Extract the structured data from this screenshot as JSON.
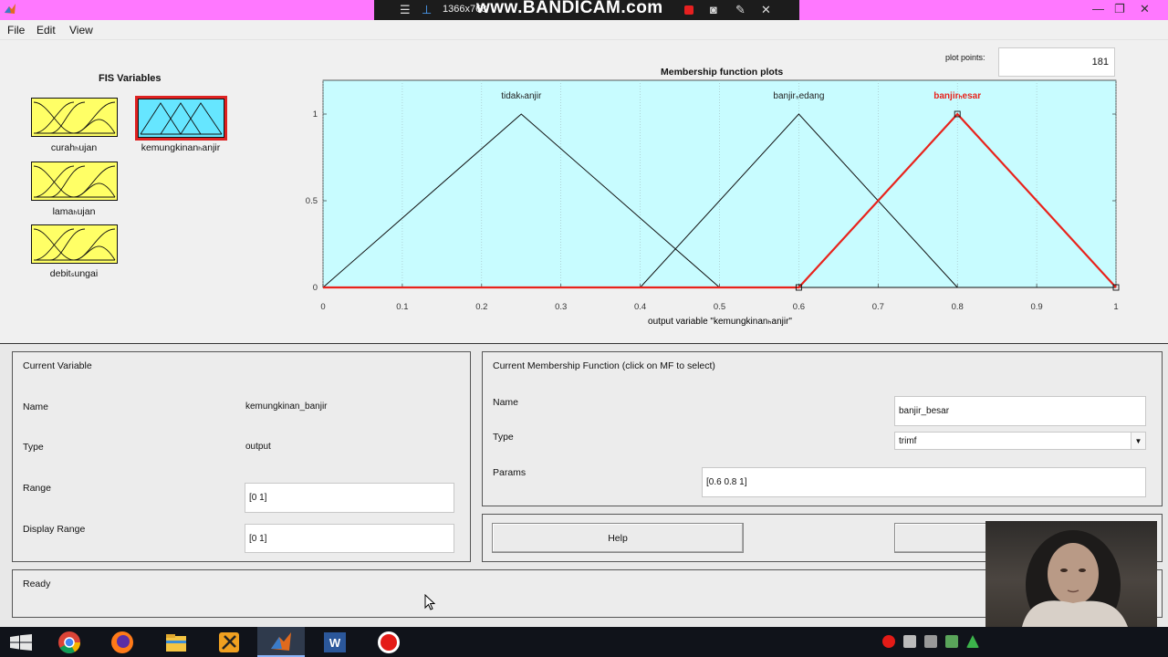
{
  "window": {
    "titlebar_color": "#ff78ff",
    "recorder": {
      "resolution": "1366x768",
      "watermark": "www.BANDICAM.com"
    }
  },
  "menu": [
    "File",
    "Edit",
    "View"
  ],
  "fis_variables": {
    "title": "FIS Variables",
    "items": [
      {
        "label": "curah_hujan",
        "label_display": "curahₕujan",
        "kind": "input",
        "selected": false
      },
      {
        "label": "kemungkinan_banjir",
        "label_display": "kemungkinanₕanjir",
        "kind": "output",
        "selected": true
      },
      {
        "label": "lama_hujan",
        "label_display": "lamaₕujan",
        "kind": "input",
        "selected": false
      },
      {
        "label": "debit_sungai",
        "label_display": "debitₛungai",
        "kind": "input",
        "selected": false
      }
    ],
    "input_color": "#ffff66",
    "output_color": "#66e6ff",
    "selected_outline": "#dd2222"
  },
  "plot": {
    "title": "Membership function plots",
    "plot_points_label": "plot points:",
    "plot_points_value": "181",
    "background": "#c8fcff",
    "xlabel": "output variable \"kemungkinanₕanjir\"",
    "xticks": [
      "0",
      "0.1",
      "0.2",
      "0.3",
      "0.4",
      "0.5",
      "0.6",
      "0.7",
      "0.8",
      "0.9",
      "1"
    ],
    "yticks": [
      "0",
      "0.5",
      "1"
    ]
  },
  "chart_data": {
    "type": "line",
    "xlim": [
      0,
      1
    ],
    "ylim": [
      0,
      1
    ],
    "series": [
      {
        "name": "tidak_banjir",
        "label_display": "tidakₕanjir",
        "type": "trimf",
        "params": [
          0,
          0.25,
          0.5
        ],
        "color": "#111111",
        "selected": false
      },
      {
        "name": "banjir_sedang",
        "label_display": "banjirₛedang",
        "type": "trimf",
        "params": [
          0.4,
          0.6,
          0.8
        ],
        "color": "#111111",
        "selected": false
      },
      {
        "name": "banjir_besar",
        "label_display": "banjirₕesar",
        "type": "trimf",
        "params": [
          0.6,
          0.8,
          1
        ],
        "color": "#e8231c",
        "selected": true
      }
    ]
  },
  "current_variable": {
    "title": "Current Variable",
    "name_label": "Name",
    "name_value": "kemungkinan_banjir",
    "type_label": "Type",
    "type_value": "output",
    "range_label": "Range",
    "range_value": "[0 1]",
    "display_range_label": "Display Range",
    "display_range_value": "[0 1]"
  },
  "current_mf": {
    "title": "Current Membership Function (click on MF to select)",
    "name_label": "Name",
    "name_value": "banjir_besar",
    "type_label": "Type",
    "type_value": "trimf",
    "params_label": "Params",
    "params_value": "[0.6 0.8 1]"
  },
  "buttons": {
    "help": "Help"
  },
  "status": "Ready"
}
